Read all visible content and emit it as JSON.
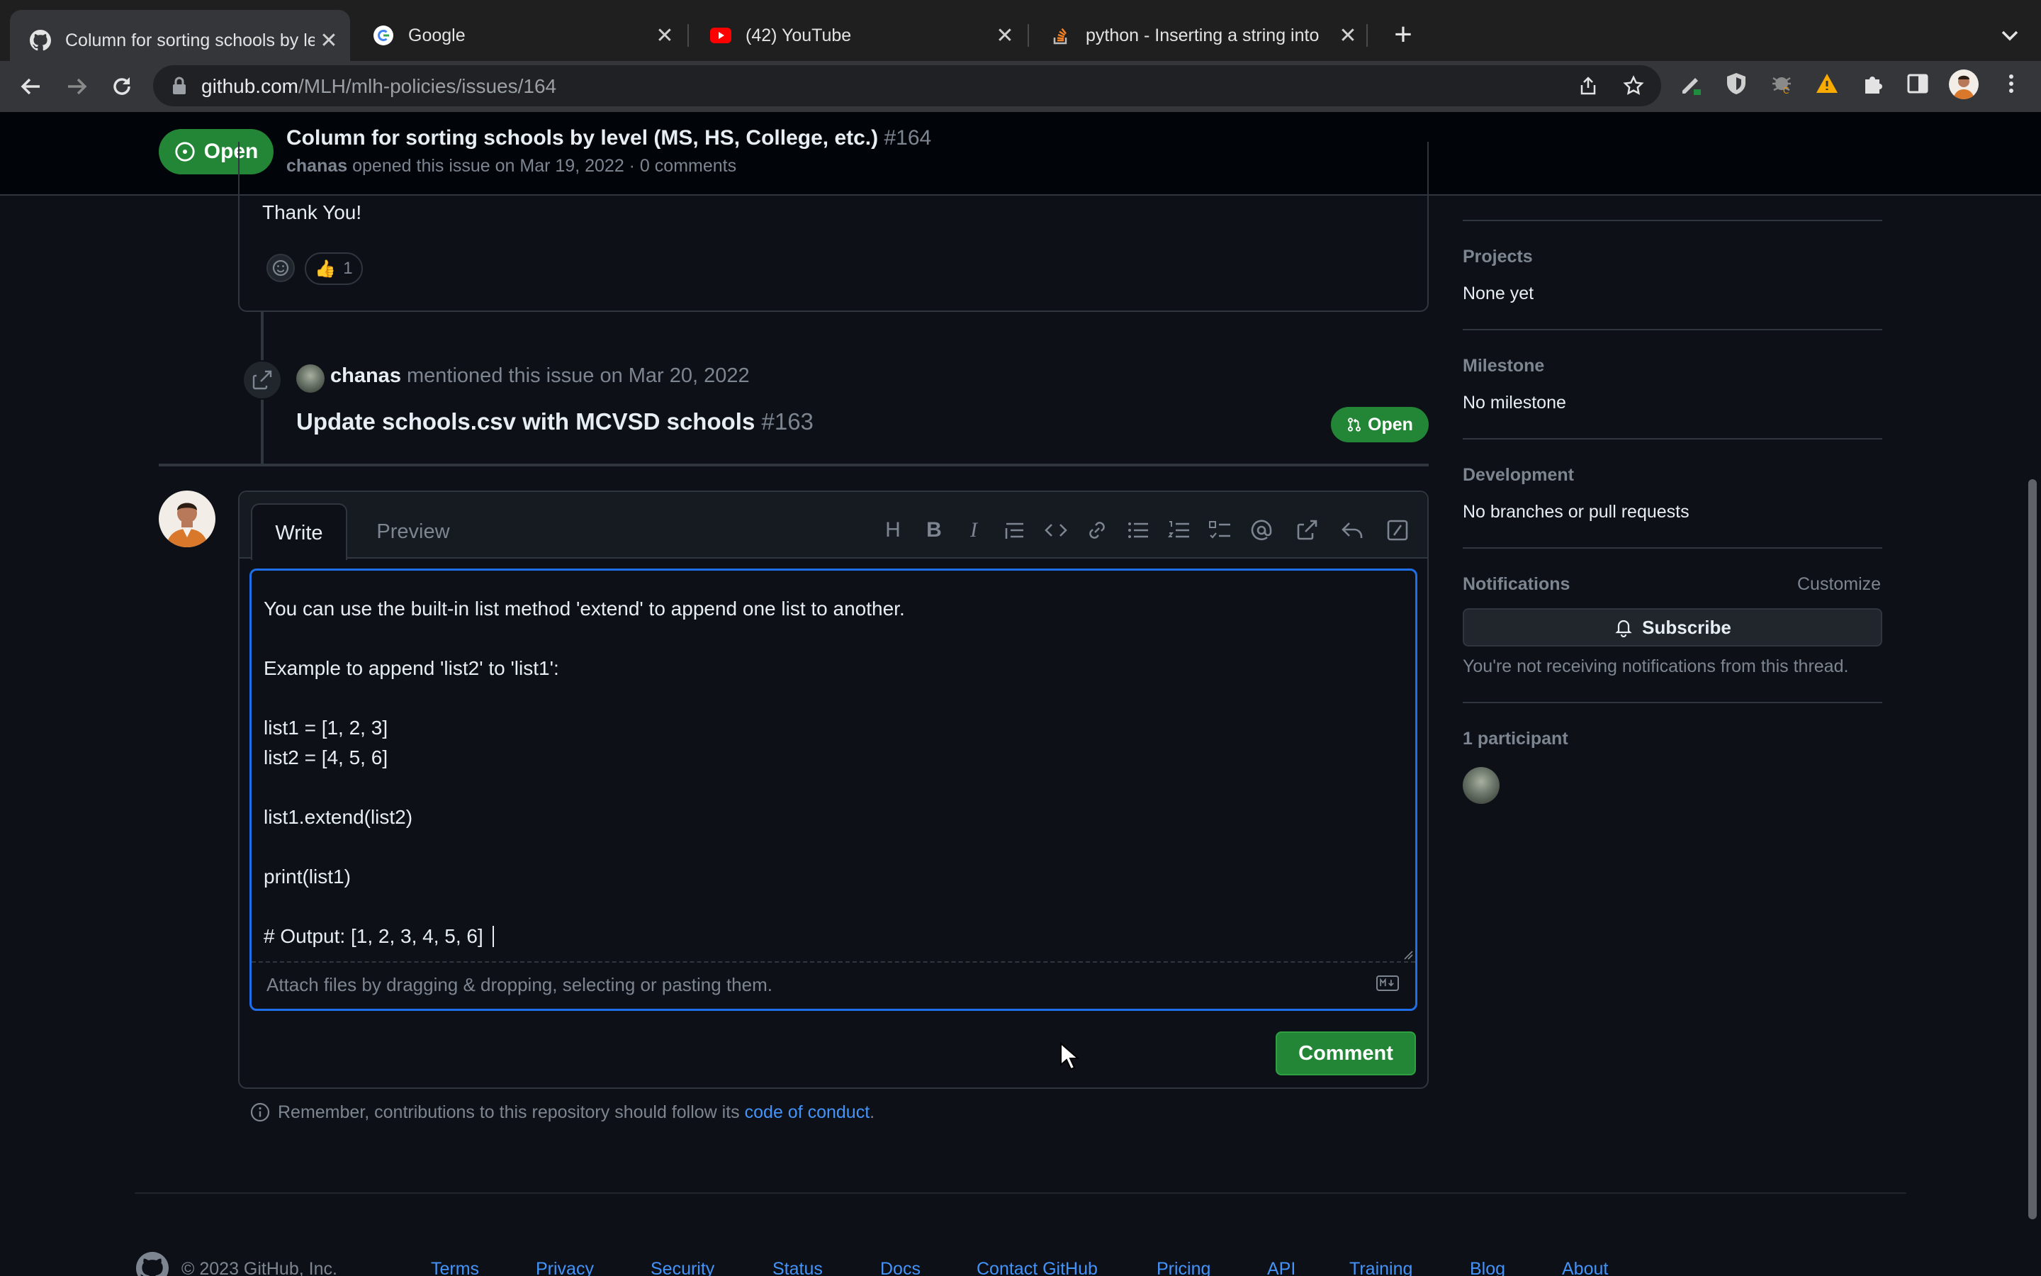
{
  "browser": {
    "tabs": [
      {
        "title": "Column for sorting schools by level",
        "icon": "github-icon"
      },
      {
        "title": "Google",
        "icon": "google-icon"
      },
      {
        "title": "(42) YouTube",
        "icon": "youtube-icon"
      },
      {
        "title": "python - Inserting a string into",
        "icon": "stackoverflow-icon"
      }
    ],
    "url_host": "github.com",
    "url_path": "/MLH/mlh-policies/issues/164"
  },
  "issue": {
    "state": "Open",
    "title": "Column for sorting schools by level (MS, HS, College, etc.)",
    "number": "#164",
    "author": "chanas",
    "opened_text": "opened this issue on Mar 19, 2022 · 0 comments"
  },
  "timeline": {
    "comment_tail": "Thank You!",
    "reaction": {
      "emoji": "👍",
      "count": "1"
    },
    "mention": {
      "user": "chanas",
      "text": "mentioned this issue on Mar 20, 2022",
      "pr_title": "Update schools.csv with MCVSD schools",
      "pr_number": "#163",
      "pr_state": "Open"
    }
  },
  "comment_form": {
    "tab_write": "Write",
    "tab_preview": "Preview",
    "toolbar_icons": [
      "heading-icon",
      "bold-icon",
      "italic-icon",
      "quote-icon",
      "code-icon",
      "link-icon",
      "bulleted-list-icon",
      "numbered-list-icon",
      "task-list-icon",
      "mention-icon",
      "cross-reference-icon",
      "reply-icon",
      "slash-command-icon"
    ],
    "body": "You can use the built-in list method 'extend' to append one list to another.\n\nExample to append 'list2' to 'list1':\n\nlist1 = [1, 2, 3]\nlist2 = [4, 5, 6]\n\nlist1.extend(list2)\n\nprint(list1)\n\n# Output: [1, 2, 3, 4, 5, 6]",
    "attach_hint": "Attach files by dragging & dropping, selecting or pasting them.",
    "markdown_badge": "MD",
    "submit_label": "Comment",
    "coc_prefix": "Remember, contributions to this repository should follow its ",
    "coc_link": "code of conduct",
    "coc_suffix": "."
  },
  "sidebar": {
    "projects_label": "Projects",
    "projects_value": "None yet",
    "milestone_label": "Milestone",
    "milestone_value": "No milestone",
    "development_label": "Development",
    "development_value": "No branches or pull requests",
    "notifications_label": "Notifications",
    "customize_label": "Customize",
    "subscribe_label": "Subscribe",
    "notifications_note": "You're not receiving notifications from this thread.",
    "participants_label": "1 participant"
  },
  "footer": {
    "copyright": "© 2023 GitHub, Inc.",
    "links": [
      "Terms",
      "Privacy",
      "Security",
      "Status",
      "Docs",
      "Contact GitHub",
      "Pricing",
      "API",
      "Training",
      "Blog",
      "About"
    ]
  },
  "colors": {
    "accent_green": "#238636",
    "focus_blue": "#1f6feb",
    "link_blue": "#4493f8",
    "background": "#0d1117"
  }
}
